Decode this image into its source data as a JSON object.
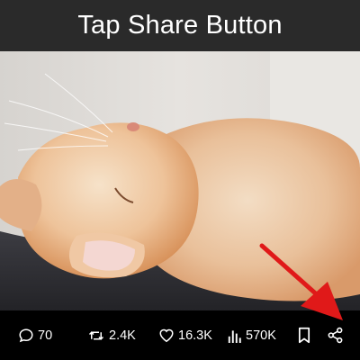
{
  "title": "Tap Share Button",
  "colors": {
    "title_bar_bg": "#2a2a2a",
    "action_bar_bg": "#000000",
    "action_text": "#ffffff",
    "annotation_arrow": "#e01919"
  },
  "actions": [
    {
      "icon": "reply-icon",
      "count": "70"
    },
    {
      "icon": "repost-icon",
      "count": "2.4K"
    },
    {
      "icon": "like-icon",
      "count": "16.3K"
    },
    {
      "icon": "views-icon",
      "count": "570K"
    },
    {
      "icon": "bookmark-icon"
    },
    {
      "icon": "share-icon"
    }
  ],
  "annotation": {
    "points_to": "share-icon"
  },
  "image": {
    "subject": "cat-photo"
  }
}
